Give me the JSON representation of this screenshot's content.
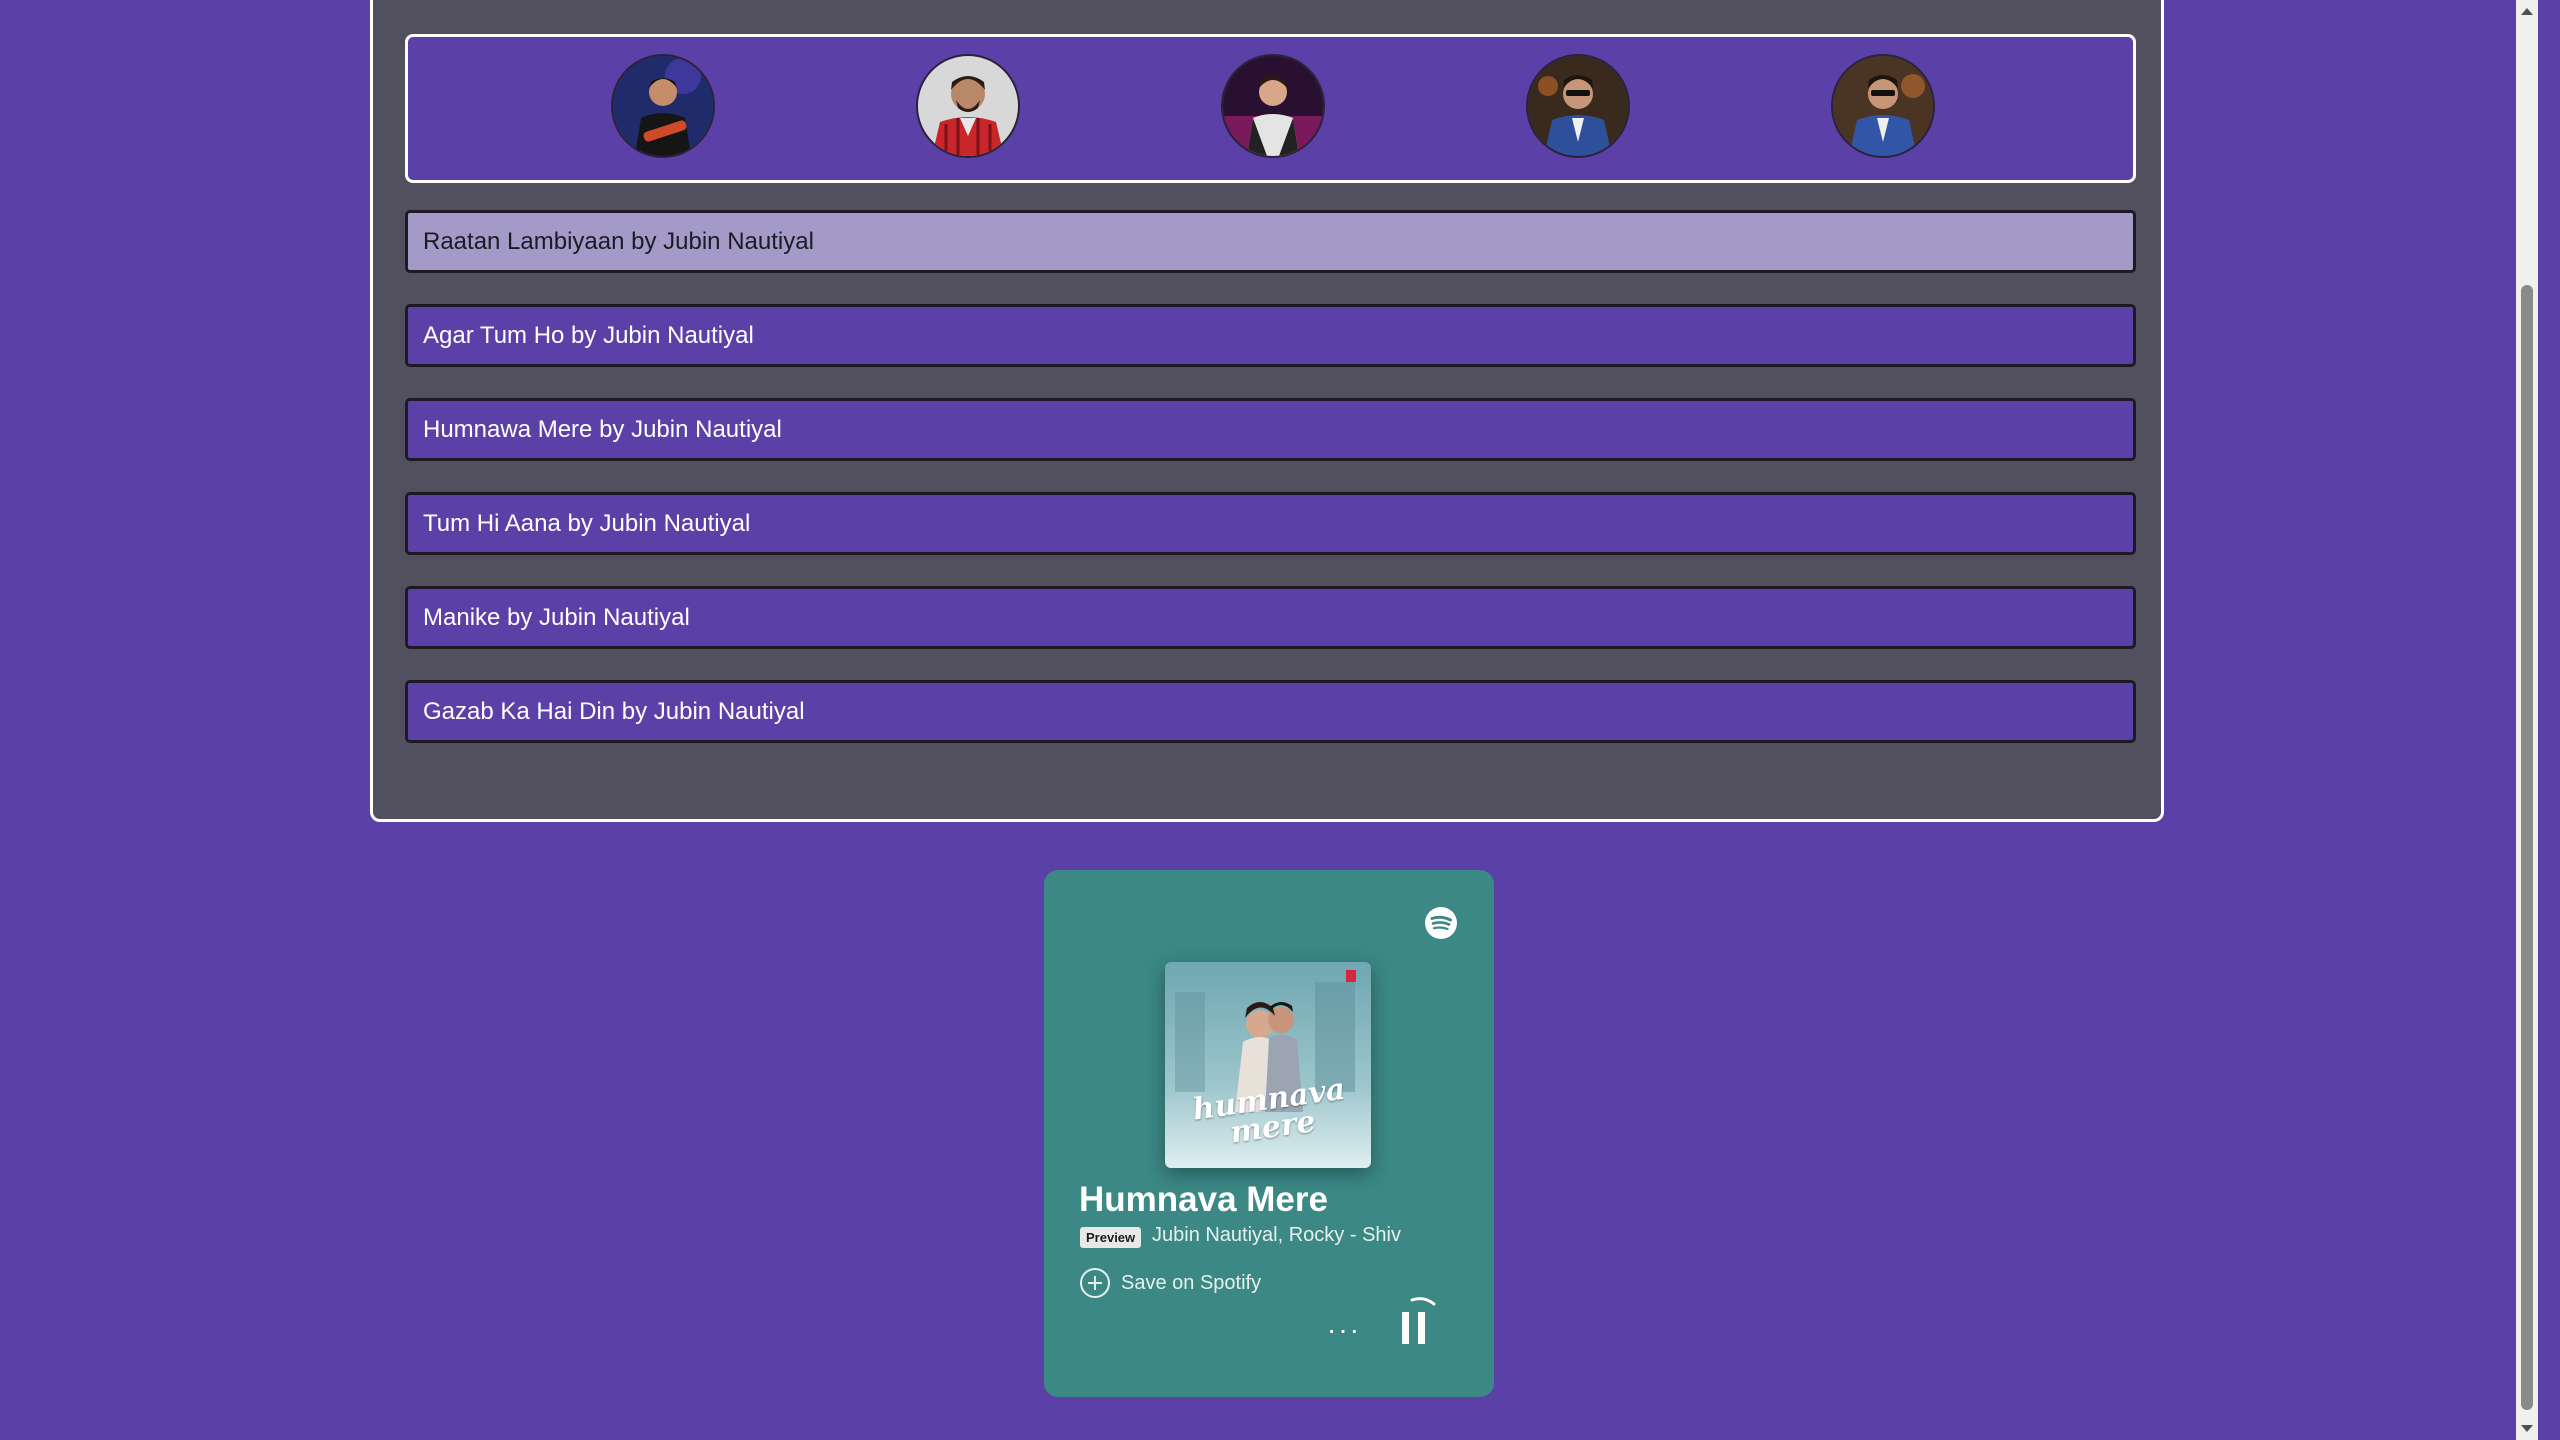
{
  "artists": [
    {
      "icon": "artist-1-avatar"
    },
    {
      "icon": "artist-2-avatar"
    },
    {
      "icon": "artist-3-avatar"
    },
    {
      "icon": "artist-4-avatar"
    },
    {
      "icon": "artist-5-avatar"
    }
  ],
  "songs": [
    {
      "label": "Raatan Lambiyaan by Jubin Nautiyal",
      "active": true
    },
    {
      "label": "Agar Tum Ho by Jubin Nautiyal",
      "active": false
    },
    {
      "label": "Humnawa Mere by Jubin Nautiyal",
      "active": false
    },
    {
      "label": "Tum Hi Aana by Jubin Nautiyal",
      "active": false
    },
    {
      "label": "Manike by Jubin Nautiyal",
      "active": false
    },
    {
      "label": "Gazab Ka Hai Din by Jubin Nautiyal",
      "active": false
    }
  ],
  "embed": {
    "title": "Humnava Mere",
    "preview_badge": "Preview",
    "artists": "Jubin Nautiyal, Rocky - Shiv",
    "save_label": "Save on Spotify",
    "more_label": "···",
    "cover_text": "humnava mere",
    "playing": true
  },
  "colors": {
    "background": "#5b40a8",
    "panel": "#52505e",
    "active_row": "#a39ac8",
    "embed_bg": "#3b8885"
  }
}
